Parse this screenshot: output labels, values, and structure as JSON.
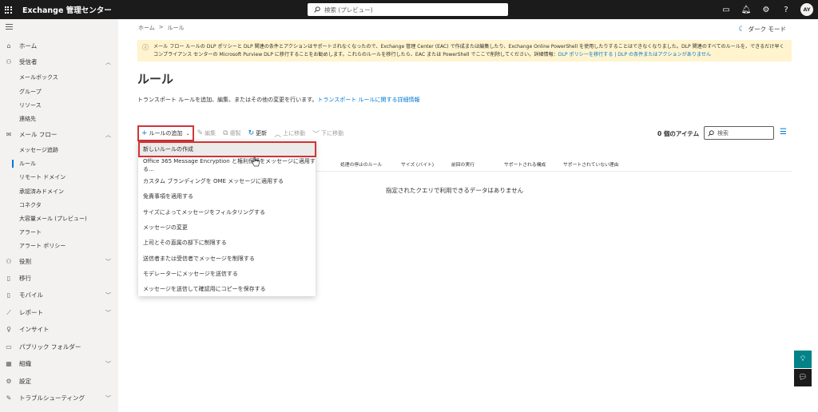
{
  "topbar": {
    "app_title": "Exchange 管理センター",
    "search_placeholder": "検索 (プレビュー)",
    "avatar_initials": "AY",
    "help_label": "?"
  },
  "sidebar": {
    "items": [
      {
        "label": "ホーム",
        "icon": "home-icon"
      },
      {
        "label": "受信者",
        "icon": "person-icon",
        "expanded": true
      },
      {
        "label": "メールボックス"
      },
      {
        "label": "グループ"
      },
      {
        "label": "リソース"
      },
      {
        "label": "連絡先"
      },
      {
        "label": "メール フロー",
        "icon": "mail-icon",
        "expanded": true
      },
      {
        "label": "メッセージ追跡"
      },
      {
        "label": "ルール",
        "active": true
      },
      {
        "label": "リモート ドメイン"
      },
      {
        "label": "承認済みドメイン"
      },
      {
        "label": "コネクタ"
      },
      {
        "label": "大容量メール (プレビュー)"
      },
      {
        "label": "アラート"
      },
      {
        "label": "アラート ポリシー"
      },
      {
        "label": "役割",
        "icon": "roles-icon"
      },
      {
        "label": "移行",
        "icon": "migration-icon"
      },
      {
        "label": "モバイル",
        "icon": "mobile-icon"
      },
      {
        "label": "レポート",
        "icon": "reports-icon"
      },
      {
        "label": "インサイト",
        "icon": "insights-icon"
      },
      {
        "label": "パブリック フォルダー",
        "icon": "folder-icon"
      },
      {
        "label": "組織",
        "icon": "org-icon"
      },
      {
        "label": "設定",
        "icon": "settings-icon"
      },
      {
        "label": "トラブルシューティング",
        "icon": "troubleshoot-icon"
      }
    ]
  },
  "breadcrumb": {
    "home": "ホーム",
    "sep": ">",
    "current": "ルール"
  },
  "darkmode_label": "ダーク モード",
  "banner": {
    "text": "メール フロー ルールの DLP ポリシーと DLP 関連の条件とアクションはサポートされなくなったので、Exchange 管理 Center (EAC) で作成または編集したり、Exchange Online PowerShell を使用したりすることはできなくなりました。DLP 関連のすべてのルールを、できるだけ早くコンプライアンス センターの Microsoft Purview DLP に移行することをお勧めします。これらのルールを移行したら、EAC または PowerShell でここで削除してください。詳細情報：",
    "link1": "DLP ポリシーを移行する",
    "sep": " | ",
    "link2": "DLP の条件またはアクションがありません"
  },
  "page_title": "ルール",
  "description": {
    "text": "トランスポート ルールを追加、編集、またはその他の変更を行います。",
    "link": "トランスポート ルールに関する詳細情報"
  },
  "toolbar": {
    "add_rule": "ルールの追加",
    "edit": "編集",
    "copy": "複製",
    "refresh": "更新",
    "move_up": "上に移動",
    "move_down": "下に移動"
  },
  "item_count": "0 個のアイテム",
  "list_search_placeholder": "検索",
  "table": {
    "headers": [
      "処理の停止のルール",
      "サイズ (バイト)",
      "前回の実行",
      "サポートされる構成",
      "サポートされていない理由"
    ],
    "empty_message": "指定されたクエリで利用できるデータはありません"
  },
  "dropdown": {
    "items": [
      "新しいルールの作成",
      "Office 365 Message Encryption と権利保護をメッセージに適用する...",
      "カスタム ブランディングを OME メッセージに適用する",
      "免責事項を適用する",
      "サイズによってメッセージをフィルタリングする",
      "メッセージの変更",
      "上司とその直属の部下に制限する",
      "送信者または受信者でメッセージを制限する",
      "モデレーターにメッセージを送信する",
      "メッセージを送信して確認用にコピーを保存する"
    ]
  }
}
